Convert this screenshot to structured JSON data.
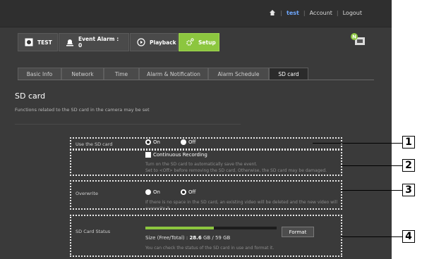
{
  "topbar": {
    "user": "test",
    "account": "Account",
    "logout": "Logout",
    "sep": "|"
  },
  "main_tabs": [
    {
      "label": "TEST",
      "icon": "camera-icon"
    },
    {
      "label": "Event Alarm : 0",
      "icon": "alarm-bell-icon"
    },
    {
      "label": "Playback",
      "icon": "play-icon"
    },
    {
      "label": "Setup",
      "icon": "gear-icon"
    }
  ],
  "sub_tabs": [
    "Basic Info",
    "Network",
    "Time",
    "Alarm & Notification",
    "Alarm Schedule",
    "SD card"
  ],
  "page": {
    "title": "SD card",
    "description": "Functions related to the SD card in the camera may be set"
  },
  "use_sd": {
    "label": "Use the SD card",
    "on": "On",
    "off": "Off",
    "selected": "On",
    "continuous": "Continuous Recording",
    "help1": "Turn on the SD card to automatically save the event.",
    "help2": "Set to <Off> before removing the SD card. Otherwise, the SD card may be damaged."
  },
  "overwrite": {
    "label": "Overwrite",
    "on": "On",
    "off": "Off",
    "selected": "Off",
    "help": "If there is no space in the SD card, an existing video will be deleted and the new video will overwrite it."
  },
  "status": {
    "label": "SD Card Status",
    "size_prefix": "Size (Free/Total) : ",
    "free": "28.6",
    "size_suffix": " GB / 59 GB",
    "used_fraction": 0.52,
    "format": "Format",
    "help": "You can check the status of the SD card in use and format it."
  },
  "callouts": [
    "1",
    "2",
    "3",
    "4"
  ],
  "colors": {
    "accent": "#8cc63f",
    "link": "#6fa8ff",
    "panel": "#3a3a3a"
  }
}
